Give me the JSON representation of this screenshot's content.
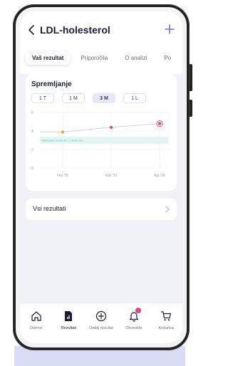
{
  "header": {
    "title": "LDL-holesterol"
  },
  "tabs": [
    {
      "label": "Vaš rezultat",
      "active": true
    },
    {
      "label": "Priporočila",
      "active": false
    },
    {
      "label": "O analizi",
      "active": false
    },
    {
      "label": "Po",
      "active": false
    }
  ],
  "tracking": {
    "title": "Spremljanje",
    "ranges": [
      "1 T",
      "1 M",
      "3 M",
      "1 L"
    ],
    "selected_range": "3 M"
  },
  "chart_data": {
    "type": "line",
    "x": [
      "Feb '20",
      "Mar '20",
      "Apr '20"
    ],
    "y_ticks": [
      0,
      2,
      4,
      6
    ],
    "ylim": [
      0,
      6
    ],
    "band": {
      "low": 2.6,
      "high": 3.4,
      "label": "Optimalna vrednost < 2.6 mmol/L"
    },
    "series": [
      {
        "points": [
          {
            "x": "Feb '20",
            "y": 3.9,
            "color": "#f2a531"
          },
          {
            "x": "Mar '20",
            "y": 4.4,
            "color": "#e0457b"
          },
          {
            "x": "Apr '20",
            "y": 4.8,
            "color": "#e0457b",
            "highlighted": true
          }
        ]
      }
    ],
    "grid": true,
    "colors": {
      "line": "#c8cbd8",
      "band": "#e3f5f2",
      "band_text": "#63c7b8",
      "grid": "#eceef5"
    }
  },
  "all_results": {
    "label": "Vsi rezultati"
  },
  "bottom_nav": [
    {
      "label": "Domov",
      "icon": "home-icon",
      "active": false
    },
    {
      "label": "Rezultati",
      "icon": "results-icon",
      "active": true
    },
    {
      "label": "Dodaj rezultat",
      "icon": "add-circle-icon",
      "active": false
    },
    {
      "label": "Obvestila",
      "icon": "bell-icon",
      "active": false,
      "badge": ""
    },
    {
      "label": "Košarica",
      "icon": "cart-icon",
      "active": false
    }
  ],
  "colors": {
    "accent": "#6b72e8",
    "dark": "#1c1c3a",
    "pink": "#e0457b",
    "orange": "#f2a531"
  }
}
